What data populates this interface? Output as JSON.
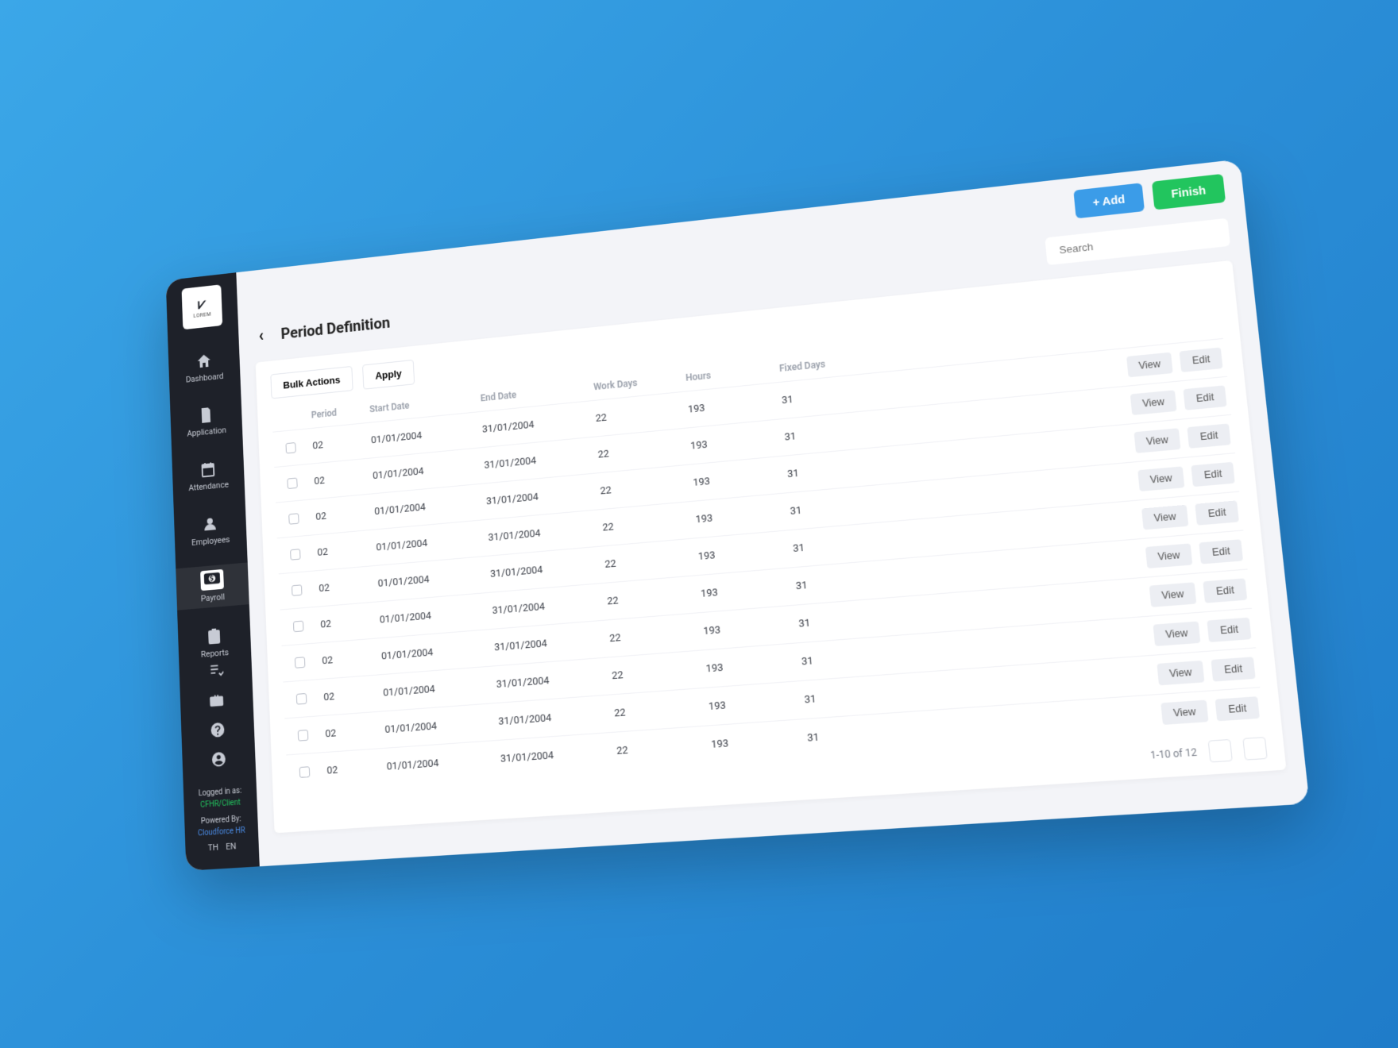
{
  "logo": {
    "mark": "⩗",
    "text": "LOREM"
  },
  "sidebar": {
    "items": [
      {
        "label": "Dashboard",
        "icon": "home"
      },
      {
        "label": "Application",
        "icon": "doc"
      },
      {
        "label": "Attendance",
        "icon": "calendar"
      },
      {
        "label": "Employees",
        "icon": "person"
      },
      {
        "label": "Payroll",
        "icon": "dollar"
      },
      {
        "label": "Reports",
        "icon": "clipboard"
      }
    ],
    "footer": {
      "logged_label": "Logged in as:",
      "logged_value": "CFHR/Client",
      "powered_label": "Powered By:",
      "powered_value": "Cloudforce HR",
      "lang_th": "TH",
      "lang_en": "EN"
    }
  },
  "topbar": {
    "add": "+ Add",
    "finish": "Finish"
  },
  "header": {
    "title": "Period Definition",
    "search_placeholder": "Search"
  },
  "toolbar": {
    "bulk": "Bulk Actions",
    "apply": "Apply"
  },
  "columns": {
    "period": "Period",
    "start": "Start Date",
    "end": "End Date",
    "workdays": "Work Days",
    "hours": "Hours",
    "fixed": "Fixed Days"
  },
  "row_actions": {
    "view": "View",
    "edit": "Edit"
  },
  "rows": [
    {
      "period": "02",
      "start": "01/01/2004",
      "end": "31/01/2004",
      "workdays": "22",
      "hours": "193",
      "fixed": "31"
    },
    {
      "period": "02",
      "start": "01/01/2004",
      "end": "31/01/2004",
      "workdays": "22",
      "hours": "193",
      "fixed": "31"
    },
    {
      "period": "02",
      "start": "01/01/2004",
      "end": "31/01/2004",
      "workdays": "22",
      "hours": "193",
      "fixed": "31"
    },
    {
      "period": "02",
      "start": "01/01/2004",
      "end": "31/01/2004",
      "workdays": "22",
      "hours": "193",
      "fixed": "31"
    },
    {
      "period": "02",
      "start": "01/01/2004",
      "end": "31/01/2004",
      "workdays": "22",
      "hours": "193",
      "fixed": "31"
    },
    {
      "period": "02",
      "start": "01/01/2004",
      "end": "31/01/2004",
      "workdays": "22",
      "hours": "193",
      "fixed": "31"
    },
    {
      "period": "02",
      "start": "01/01/2004",
      "end": "31/01/2004",
      "workdays": "22",
      "hours": "193",
      "fixed": "31"
    },
    {
      "period": "02",
      "start": "01/01/2004",
      "end": "31/01/2004",
      "workdays": "22",
      "hours": "193",
      "fixed": "31"
    },
    {
      "period": "02",
      "start": "01/01/2004",
      "end": "31/01/2004",
      "workdays": "22",
      "hours": "193",
      "fixed": "31"
    },
    {
      "period": "02",
      "start": "01/01/2004",
      "end": "31/01/2004",
      "workdays": "22",
      "hours": "193",
      "fixed": "31"
    }
  ],
  "pager": {
    "range": "1-10 of 12"
  }
}
